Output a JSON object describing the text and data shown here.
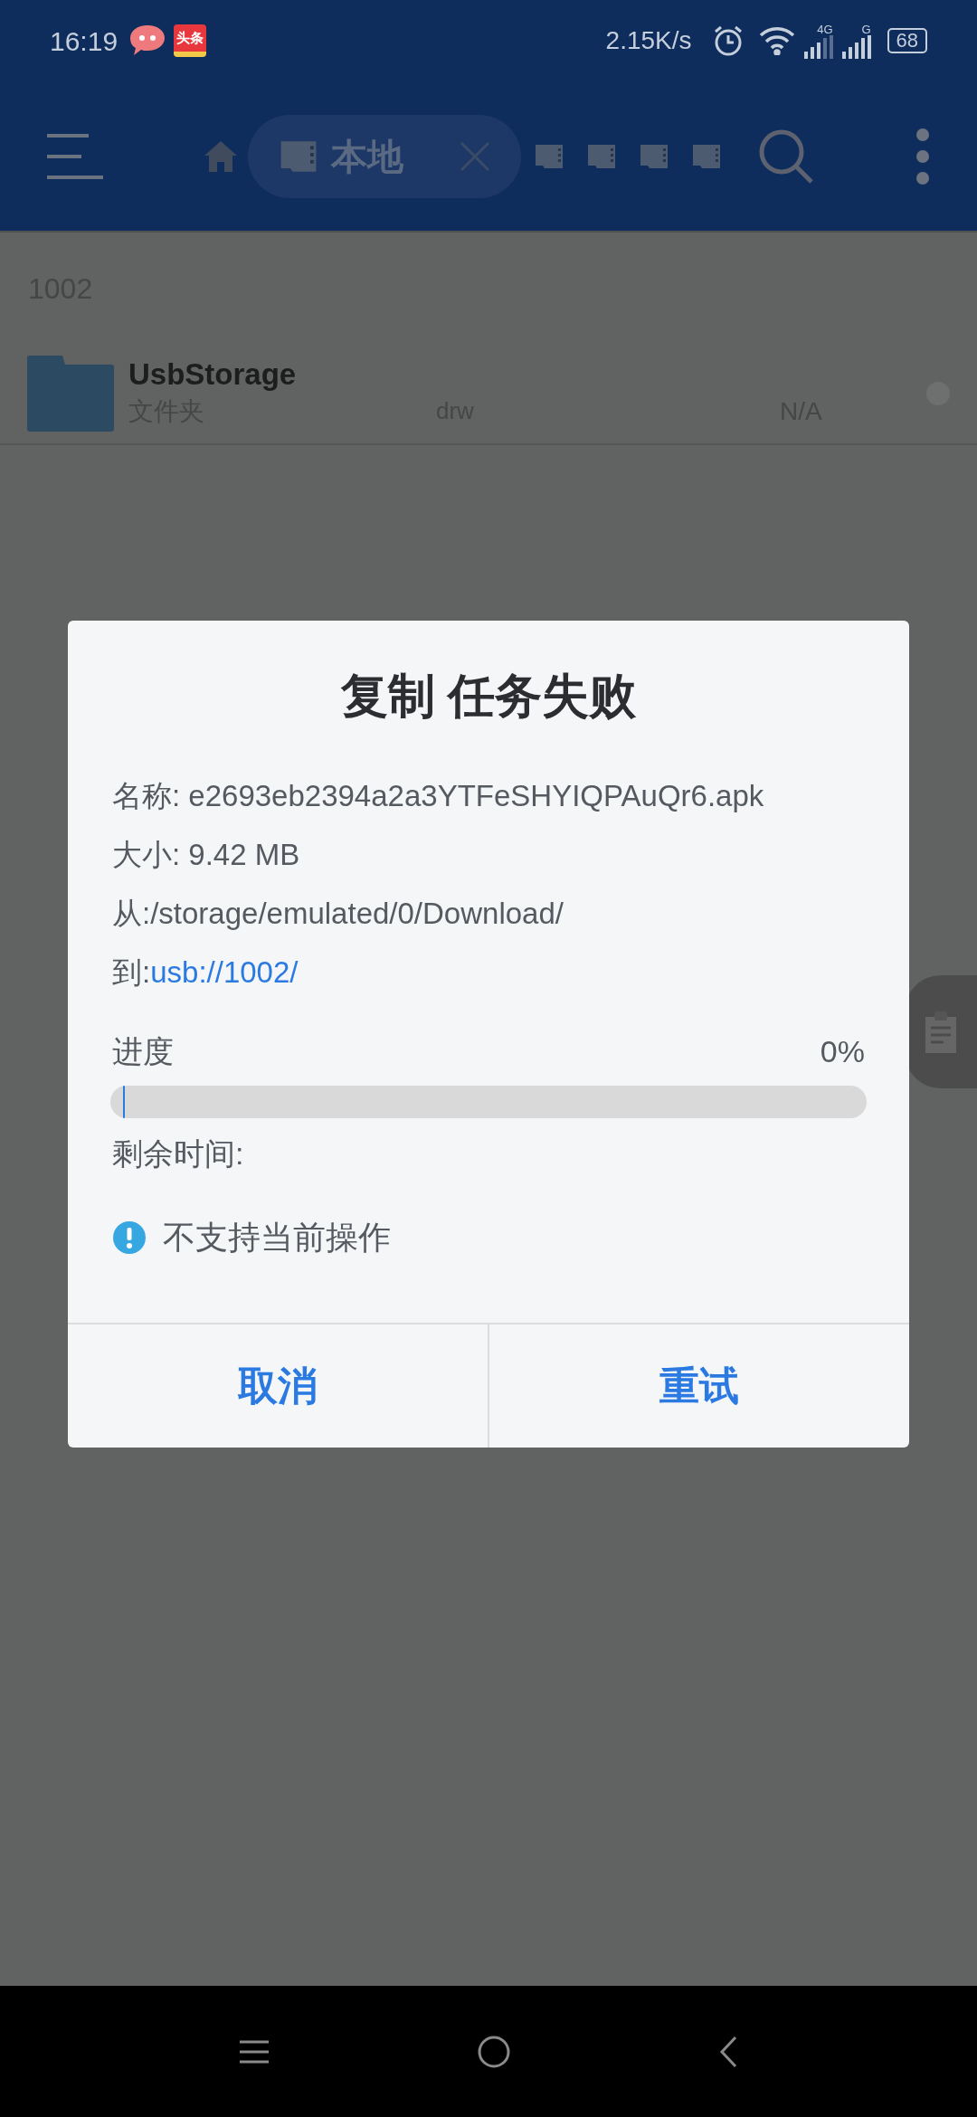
{
  "status_bar": {
    "time": "16:19",
    "app_badge": "头条",
    "speed": "2.15K/s",
    "mobile_labels": [
      "4G",
      "G"
    ],
    "battery": "68"
  },
  "toolbar": {
    "tab": {
      "label": "本地",
      "selected": true
    }
  },
  "path": "1002",
  "files": [
    {
      "name": "UsbStorage",
      "type": "文件夹",
      "permissions": "drw",
      "size": "N/A",
      "checked": false
    }
  ],
  "dialog": {
    "title": "复制 任务失败",
    "fields": [
      {
        "label": "名称: ",
        "value": "e2693eb2394a2a3YTFeSHYIQPAuQr6.apk",
        "kind": "plain"
      },
      {
        "label": "大小: ",
        "value": "9.42  MB",
        "kind": "plain"
      },
      {
        "label": "从:",
        "value": "/storage/emulated/0/Download/",
        "kind": "plain"
      },
      {
        "label": "到:",
        "value": "usb://1002/",
        "kind": "link"
      }
    ],
    "progress": {
      "label": "进度",
      "reading": "0%",
      "level": 0
    },
    "remaining": "剩余时间:",
    "error": "不支持当前操作",
    "buttons": [
      "取消",
      "重试"
    ]
  }
}
